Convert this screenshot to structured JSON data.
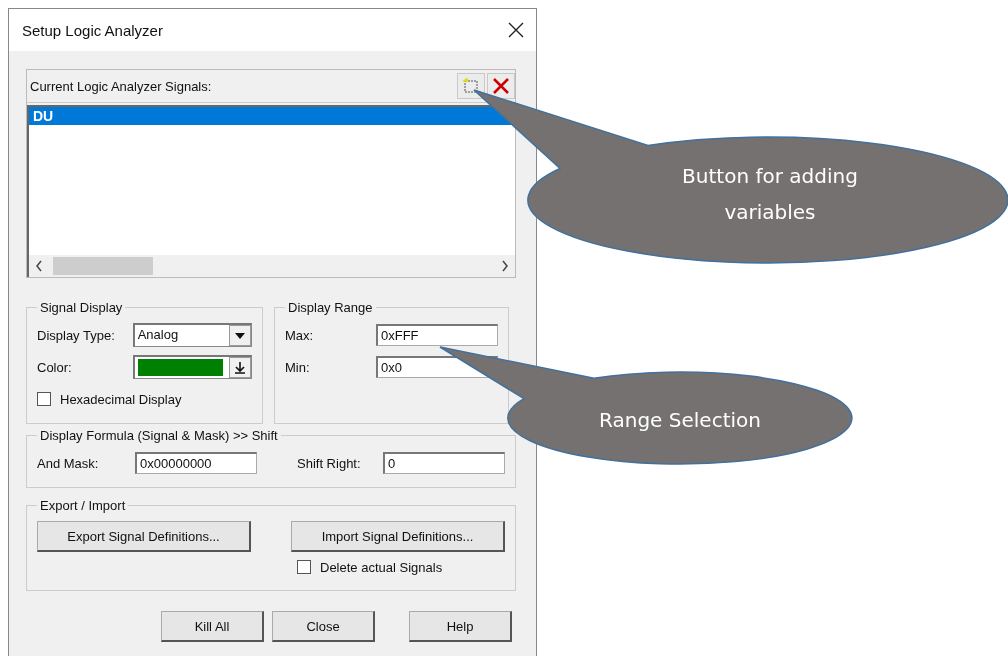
{
  "window": {
    "title": "Setup Logic Analyzer"
  },
  "signals": {
    "label": "Current Logic Analyzer Signals:",
    "items": [
      {
        "name": "DU",
        "selected": true
      }
    ]
  },
  "signal_display": {
    "title": "Signal Display",
    "display_type": {
      "label": "Display Type:",
      "value": "Analog"
    },
    "color": {
      "label": "Color:",
      "color": "#008000"
    },
    "hex": {
      "label": "Hexadecimal Display",
      "checked": false
    }
  },
  "display_range": {
    "title": "Display Range",
    "fields": [
      {
        "label": "Max:",
        "value": "0xFFF"
      },
      {
        "label": "Min:",
        "value": "0x0"
      }
    ]
  },
  "formula": {
    "title": "Display Formula (Signal & Mask) >> Shift",
    "fields": [
      {
        "label": "And Mask:",
        "value": "0x00000000"
      },
      {
        "label": "Shift Right:",
        "value": "0"
      }
    ]
  },
  "export_import": {
    "title": "Export / Import",
    "buttons": [
      "Export Signal Definitions...",
      "Import Signal Definitions..."
    ],
    "delete": {
      "label": "Delete actual Signals",
      "checked": false
    }
  },
  "buttons": [
    "Kill All",
    "Close",
    "Help"
  ],
  "callouts": [
    {
      "text": "Button for adding variables"
    },
    {
      "text": "Range Selection"
    }
  ]
}
